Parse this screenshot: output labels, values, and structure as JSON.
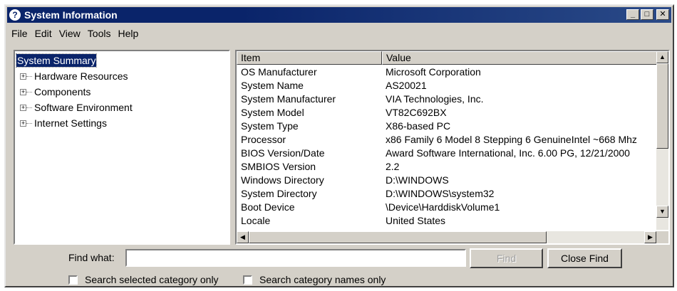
{
  "window": {
    "title": "System Information",
    "controls": {
      "minimize": "_",
      "maximize": "□",
      "close": "✕"
    }
  },
  "menu": [
    "File",
    "Edit",
    "View",
    "Tools",
    "Help"
  ],
  "tree": {
    "root": "System Summary",
    "children": [
      "Hardware Resources",
      "Components",
      "Software Environment",
      "Internet Settings"
    ]
  },
  "table": {
    "headers": {
      "item": "Item",
      "value": "Value"
    },
    "rows": [
      {
        "item": "OS Manufacturer",
        "value": "Microsoft Corporation"
      },
      {
        "item": "System Name",
        "value": "AS20021"
      },
      {
        "item": "System Manufacturer",
        "value": "VIA Technologies, Inc."
      },
      {
        "item": "System Model",
        "value": "VT82C692BX"
      },
      {
        "item": "System Type",
        "value": "X86-based PC"
      },
      {
        "item": "Processor",
        "value": "x86 Family 6 Model 8 Stepping 6 GenuineIntel ~668 Mhz"
      },
      {
        "item": "BIOS Version/Date",
        "value": "Award Software International, Inc. 6.00 PG, 12/21/2000"
      },
      {
        "item": "SMBIOS Version",
        "value": "2.2"
      },
      {
        "item": "Windows Directory",
        "value": "D:\\WINDOWS"
      },
      {
        "item": "System Directory",
        "value": "D:\\WINDOWS\\system32"
      },
      {
        "item": "Boot Device",
        "value": "\\Device\\HarddiskVolume1"
      },
      {
        "item": "Locale",
        "value": "United States"
      }
    ]
  },
  "find": {
    "label": "Find what:",
    "value": "",
    "find_button": "Find",
    "close_button": "Close Find",
    "check_selected_category": "Search selected category only",
    "check_category_names": "Search category names only"
  }
}
